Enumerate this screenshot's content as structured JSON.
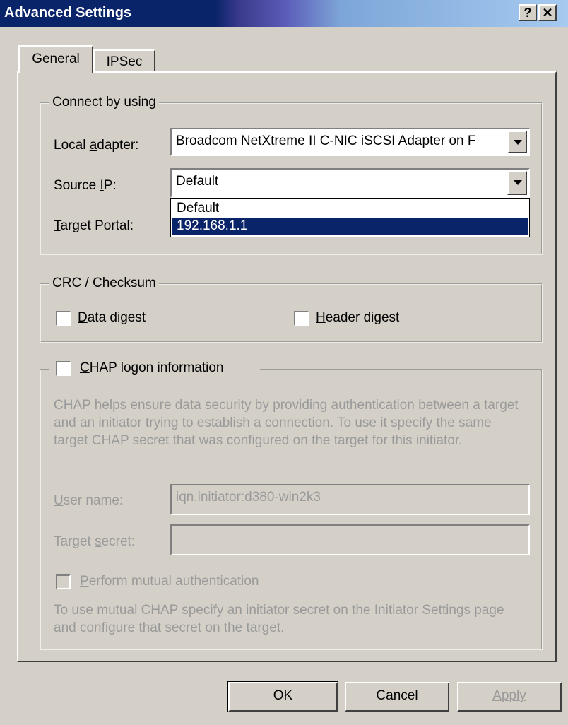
{
  "window": {
    "title": "Advanced Settings",
    "help_glyph": "?",
    "close_glyph": "✕"
  },
  "tabs": [
    {
      "label": "General",
      "selected": true
    },
    {
      "label": "IPSec",
      "selected": false
    }
  ],
  "connect": {
    "legend": "Connect by using",
    "local_adapter_label": "Local adapter:",
    "local_adapter_value": "Broadcom NetXtreme II C-NIC iSCSI Adapter on F",
    "source_ip_label": "Source IP:",
    "source_ip_value": "Default",
    "source_ip_options": [
      "Default",
      "192.168.1.1"
    ],
    "target_portal_label": "Target Portal:"
  },
  "crc": {
    "legend": "CRC / Checksum",
    "data_digest": "Data digest",
    "header_digest": "Header digest"
  },
  "chap": {
    "legend": "CHAP logon information",
    "description": "CHAP helps ensure data security by providing authentication between a target and an initiator trying to establish a connection. To use it specify the same target CHAP secret that was configured on the target for this initiator.",
    "user_name_label": "User name:",
    "user_name_value": "iqn.initiator:d380-win2k3",
    "target_secret_label": "Target secret:",
    "target_secret_value": "",
    "mutual_label": "Perform mutual authentication",
    "mutual_note": "To use mutual CHAP specify an initiator secret on the Initiator Settings page and configure that secret on the target."
  },
  "buttons": {
    "ok": "OK",
    "cancel": "Cancel",
    "apply": "Apply"
  },
  "colors": {
    "title_bar": "#0a246a",
    "selection": "#0a246a",
    "face": "#d4d0c8",
    "disabled_text": "#9a9a9a"
  }
}
